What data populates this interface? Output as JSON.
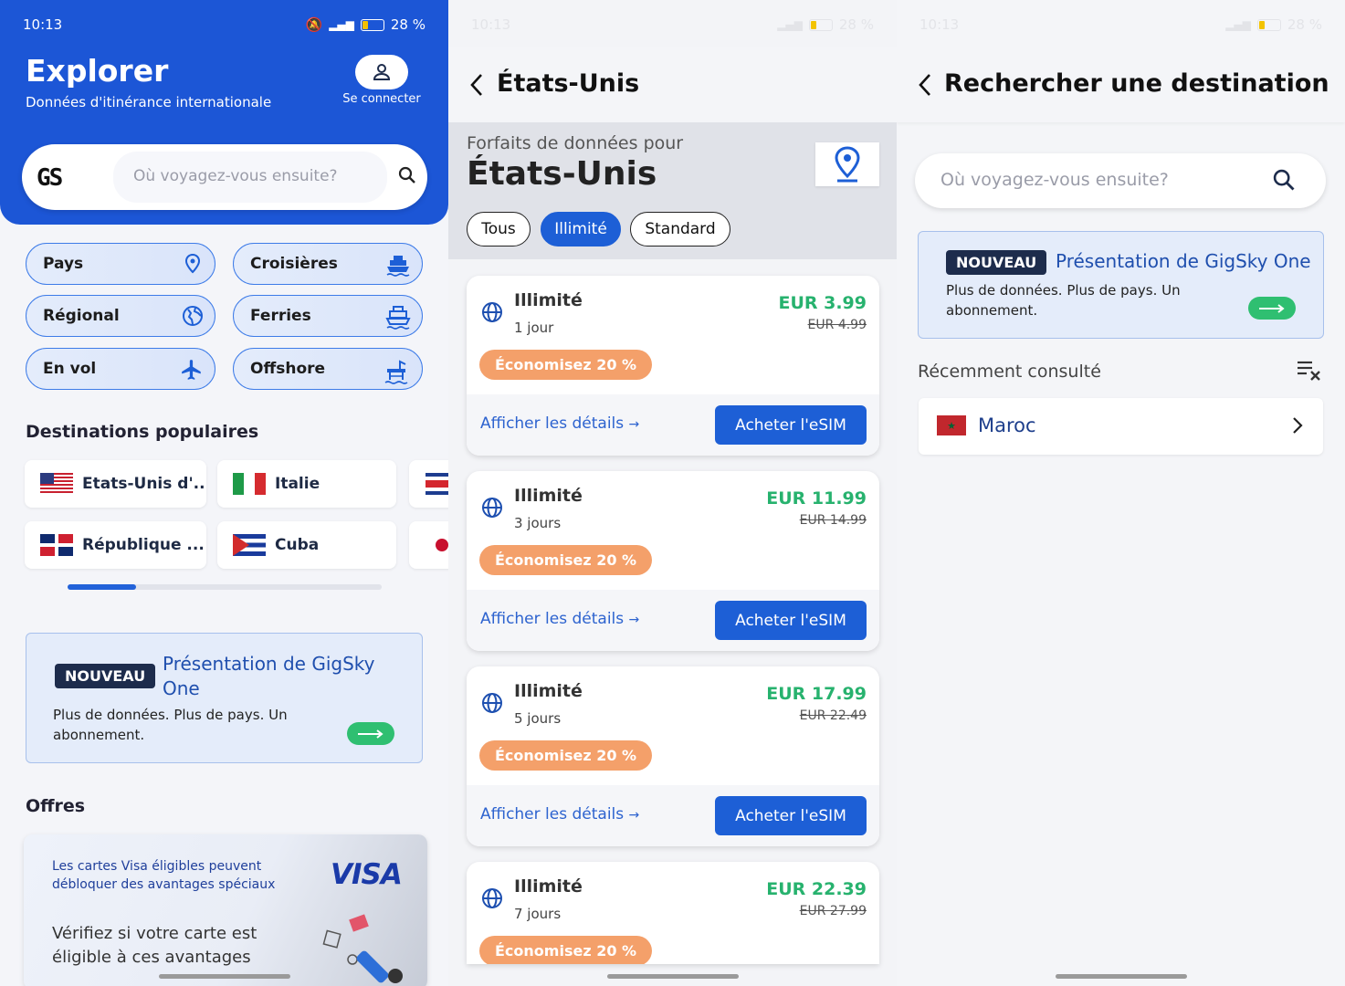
{
  "status": {
    "time": "10:13",
    "battery": "28 %"
  },
  "explore": {
    "title": "Explorer",
    "subtitle": "Données d'itinérance internationale",
    "login_label": "Se connecter",
    "search_placeholder": "Où voyagez-vous ensuite?",
    "categories": [
      {
        "label": "Pays",
        "icon": "map-pin-icon"
      },
      {
        "label": "Croisières",
        "icon": "ship-icon"
      },
      {
        "label": "Régional",
        "icon": "globe-icon"
      },
      {
        "label": "Ferries",
        "icon": "ferry-icon"
      },
      {
        "label": "En vol",
        "icon": "airplane-icon"
      },
      {
        "label": "Offshore",
        "icon": "offshore-platform-icon"
      }
    ],
    "popular_title": "Destinations populaires",
    "popular": [
      {
        "label": "Etats-Unis d'...",
        "flag": "us"
      },
      {
        "label": "Italie",
        "flag": "it"
      },
      {
        "label": "République ...",
        "flag": "do"
      },
      {
        "label": "Cuba",
        "flag": "cu"
      }
    ],
    "promo": {
      "badge": "NOUVEAU",
      "title_line1": "Présentation de GigSky",
      "title_line2": "One",
      "body_line1": "Plus de données. Plus de pays. Un",
      "body_line2": "abonnement."
    },
    "offers_title": "Offres",
    "offer": {
      "line1": "Les cartes Visa éligibles peuvent",
      "line2": "débloquer des avantages spéciaux",
      "brand": "VISA",
      "body_line1": "Vérifiez si votre carte est",
      "body_line2": "éligible à ces avantages"
    }
  },
  "plans": {
    "title": "États-Unis",
    "header_pre": "Forfaits de données pour",
    "header_country": "États-Unis",
    "filters": [
      "Tous",
      "Illimité",
      "Standard"
    ],
    "active_filter": "Illimité",
    "cards": [
      {
        "name": "Illimité",
        "duration": "1 jour",
        "price": "EUR 3.99",
        "old_price": "EUR 4.99",
        "save": "Économisez 20 %",
        "details": "Afficher les détails",
        "buy": "Acheter l'eSIM"
      },
      {
        "name": "Illimité",
        "duration": "3 jours",
        "price": "EUR 11.99",
        "old_price": "EUR 14.99",
        "save": "Économisez 20 %",
        "details": "Afficher les détails",
        "buy": "Acheter l'eSIM"
      },
      {
        "name": "Illimité",
        "duration": "5 jours",
        "price": "EUR 17.99",
        "old_price": "EUR 22.49",
        "save": "Économisez 20 %",
        "details": "Afficher les détails",
        "buy": "Acheter l'eSIM"
      },
      {
        "name": "Illimité",
        "duration": "7 jours",
        "price": "EUR 22.39",
        "old_price": "EUR 27.99",
        "save": "Économisez 20 %"
      }
    ]
  },
  "search": {
    "title": "Rechercher une destination",
    "placeholder": "Où voyagez-vous ensuite?",
    "promo": {
      "badge": "NOUVEAU",
      "title": "Présentation de GigSky One",
      "body_line1": "Plus de données. Plus de pays. Un",
      "body_line2": "abonnement."
    },
    "recent_label": "Récemment consulté",
    "recent_items": [
      {
        "name": "Maroc",
        "flag": "ma"
      }
    ]
  },
  "colors": {
    "brand_blue": "#1c56d6",
    "price_green": "#27b26e",
    "save_orange": "#f4a06a",
    "badge_navy": "#1d2c4c"
  }
}
